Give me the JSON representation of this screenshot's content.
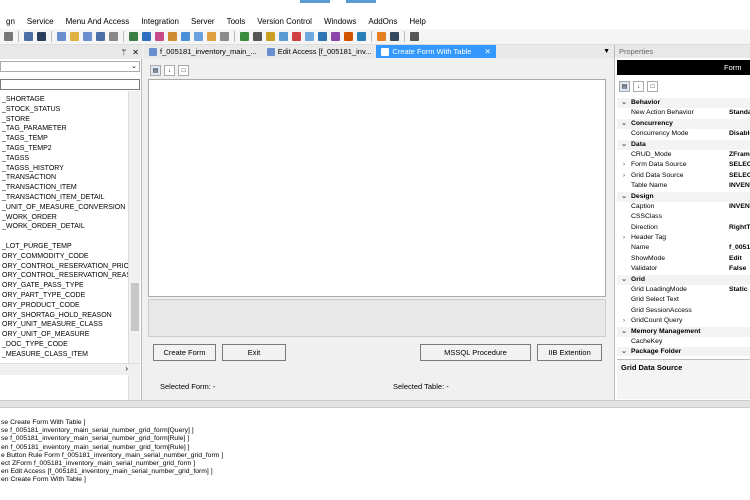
{
  "menu": [
    "gn",
    "Service",
    "Menu And Access",
    "Integration",
    "Server",
    "Tools",
    "Version Control",
    "Windows",
    "AddOns",
    "Help"
  ],
  "left_panel": {
    "pin": "ᛘ",
    "close": "✕",
    "tables": [
      "_SHORTAGE",
      "_STOCK_STATUS",
      "_STORE",
      "_TAG_PARAMETER",
      "_TAGS_TEMP",
      "_TAGS_TEMP2",
      "_TAGSS",
      "_TAGSS_HISTORY",
      "_TRANSACTION",
      "_TRANSACTION_ITEM",
      "_TRANSACTION_ITEM_DETAIL",
      "_UNIT_OF_MEASURE_CONVERSION",
      "_WORK_ORDER",
      "_WORK_ORDER_DETAIL",
      "",
      "_LOT_PURGE_TEMP",
      "ORY_COMMODITY_CODE",
      "ORY_CONTROL_RESERVATION_PRIORITY",
      "ORY_CONTROL_RESERVATION_REASON",
      "ORY_GATE_PASS_TYPE",
      "ORY_PART_TYPE_CODE",
      "ORY_PRODUCT_CODE",
      "ORY_SHORTAG_HOLD_REASON",
      "ORY_UNIT_MEASURE_CLASS",
      "ORY_UNIT_OF_MEASURE",
      "_DOC_TYPE_CODE",
      "_MEASURE_CLASS_ITEM"
    ]
  },
  "tabs": [
    {
      "label": "f_005181_inventory_main_...",
      "active": false
    },
    {
      "label": "Edit Access  [f_005181_inv...",
      "active": false
    },
    {
      "label": "Create Form With Table",
      "active": true
    }
  ],
  "designer": {
    "buttons": {
      "create_form": "Create Form",
      "exit": "Exit",
      "mssql": "MSSQL Procedure",
      "iib": "IIB Extention"
    },
    "selected_form_label": "Selected Form:  -",
    "selected_table_label": "Selected Table:  -"
  },
  "properties": {
    "title": "Properties",
    "object": "Form",
    "rows": [
      {
        "kind": "cat",
        "gut": "⌄",
        "name": "Behavior",
        "value": ""
      },
      {
        "kind": "prop",
        "gut": "",
        "name": "New Action Behavior",
        "value": "Standa"
      },
      {
        "kind": "cat",
        "gut": "⌄",
        "name": "Concurrency",
        "value": ""
      },
      {
        "kind": "prop",
        "gut": "",
        "name": "Concurrency Mode",
        "value": "Disable"
      },
      {
        "kind": "cat",
        "gut": "⌄",
        "name": "Data",
        "value": ""
      },
      {
        "kind": "prop",
        "gut": "",
        "name": "CRUD_Mode",
        "value": "ZFram"
      },
      {
        "kind": "prop",
        "gut": "›",
        "name": "Form Data Source",
        "value": "SELEC"
      },
      {
        "kind": "prop",
        "gut": "›",
        "name": "Grid Data Source",
        "value": "SELECT"
      },
      {
        "kind": "prop",
        "gut": "",
        "name": "Table Name",
        "value": "INVENT"
      },
      {
        "kind": "cat",
        "gut": "⌄",
        "name": "Design",
        "value": ""
      },
      {
        "kind": "prop",
        "gut": "",
        "name": "Caption",
        "value": "INVENT"
      },
      {
        "kind": "prop",
        "gut": "",
        "name": "CSSClass",
        "value": ""
      },
      {
        "kind": "prop",
        "gut": "",
        "name": "Direction",
        "value": "RightT"
      },
      {
        "kind": "prop",
        "gut": "›",
        "name": "Header Tag",
        "value": ""
      },
      {
        "kind": "prop",
        "gut": "",
        "name": "Name",
        "value": "f_0051"
      },
      {
        "kind": "prop",
        "gut": "",
        "name": "ShowMode",
        "value": "Edit"
      },
      {
        "kind": "prop",
        "gut": "",
        "name": "Validator",
        "value": "False"
      },
      {
        "kind": "cat",
        "gut": "⌄",
        "name": "Grid",
        "value": ""
      },
      {
        "kind": "prop",
        "gut": "",
        "name": "Grid LoadingMode",
        "value": "Static"
      },
      {
        "kind": "prop",
        "gut": "",
        "name": "Grid Select Text",
        "value": ""
      },
      {
        "kind": "prop",
        "gut": "",
        "name": "Grid SessionAccess",
        "value": ""
      },
      {
        "kind": "prop",
        "gut": "›",
        "name": "GridCount Query",
        "value": ""
      },
      {
        "kind": "cat",
        "gut": "⌄",
        "name": "Memory Management",
        "value": ""
      },
      {
        "kind": "prop",
        "gut": "",
        "name": "CacheKey",
        "value": ""
      },
      {
        "kind": "cat",
        "gut": "⌄",
        "name": "Package Folder",
        "value": ""
      }
    ],
    "description_title": "Grid Data Source"
  },
  "output": [
    "se Create Form With Table ]",
    "se f_005181_inventory_main_serial_number_grid_form[Query] ]",
    "se f_005181_inventory_main_serial_number_grid_form[Rule] ]",
    "en f_005181_inventory_main_serial_number_grid_form[Rule] ]",
    "e Button Rule Form f_005181_inventory_main_serial_number_grid_form ]",
    "ect ZForm f_005181_inventory_main_serial_number_grid_form ]",
    "en Edit Access  [f_005181_inventory_main_serial_number_grid_form] ]",
    "en Create Form With Table ]"
  ],
  "colors": {
    "accent": "#3399ff",
    "object_header": "#000000"
  }
}
